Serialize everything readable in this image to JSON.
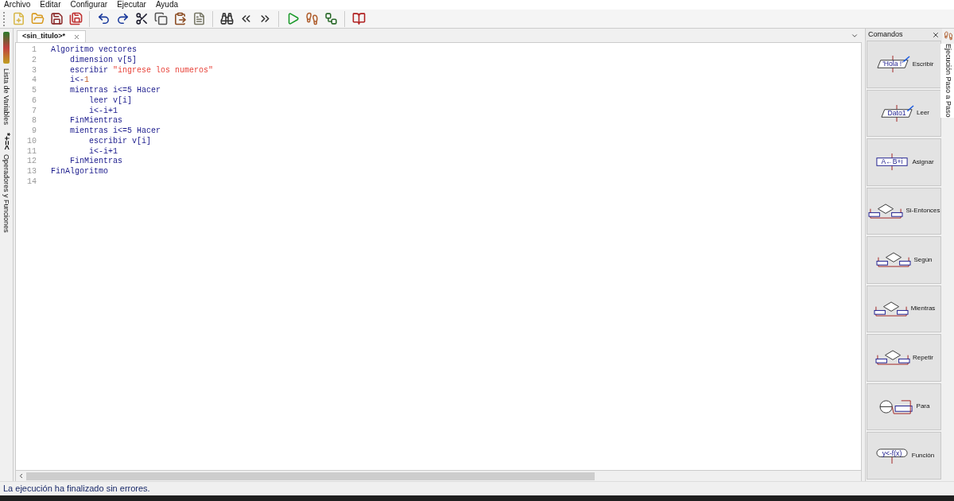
{
  "menu": [
    {
      "label": "Archivo"
    },
    {
      "label": "Editar"
    },
    {
      "label": "Configurar"
    },
    {
      "label": "Ejecutar"
    },
    {
      "label": "Ayuda"
    }
  ],
  "left_panel": {
    "variables_label": "Lista de Variables",
    "operators_symbols": "*+=<",
    "operators_label": "Operadores y Funciones"
  },
  "tabs": [
    {
      "label": "<sin_titulo>*",
      "selected": true
    }
  ],
  "code": [
    {
      "number": "1",
      "tokens": [
        {
          "kind": "keyword",
          "text": "Algoritmo vectores"
        }
      ]
    },
    {
      "number": "2",
      "tokens": [
        {
          "kind": "keyword",
          "text": "    dimension v[5]"
        }
      ]
    },
    {
      "number": "3",
      "tokens": [
        {
          "kind": "keyword",
          "text": "    escribir "
        },
        {
          "kind": "string",
          "text": "\"ingrese los numeros\""
        }
      ]
    },
    {
      "number": "4",
      "tokens": [
        {
          "kind": "keyword",
          "text": "    i<-"
        },
        {
          "kind": "number",
          "text": "1"
        }
      ]
    },
    {
      "number": "5",
      "tokens": [
        {
          "kind": "keyword",
          "text": "    mientras i<=5 Hacer"
        }
      ]
    },
    {
      "number": "6",
      "tokens": [
        {
          "kind": "keyword",
          "text": "        leer v[i]"
        }
      ]
    },
    {
      "number": "7",
      "tokens": [
        {
          "kind": "keyword",
          "text": "        i<-i+1"
        }
      ]
    },
    {
      "number": "8",
      "tokens": [
        {
          "kind": "keyword",
          "text": "    FinMientras"
        }
      ]
    },
    {
      "number": "9",
      "tokens": [
        {
          "kind": "keyword",
          "text": "    mientras i<=5 Hacer"
        }
      ]
    },
    {
      "number": "10",
      "tokens": [
        {
          "kind": "keyword",
          "text": "        escribir v[i]"
        }
      ]
    },
    {
      "number": "11",
      "tokens": [
        {
          "kind": "keyword",
          "text": "        i<-i+1"
        }
      ]
    },
    {
      "number": "12",
      "tokens": [
        {
          "kind": "keyword",
          "text": "    FinMientras"
        }
      ]
    },
    {
      "number": "13",
      "tokens": [
        {
          "kind": "keyword",
          "text": "FinAlgoritmo"
        }
      ]
    },
    {
      "number": "14"
    }
  ],
  "commands_panel": {
    "title": "Comandos",
    "items": [
      {
        "kind": "escribir",
        "label": "Escribir",
        "icon_text": "'Hola !'"
      },
      {
        "kind": "leer",
        "label": "Leer",
        "icon_text": "Dato1"
      },
      {
        "kind": "asignar",
        "label": "Asignar",
        "icon_text": "A←B+i"
      },
      {
        "kind": "si",
        "label": "Si-Entonces"
      },
      {
        "kind": "segun",
        "label": "Según"
      },
      {
        "kind": "mientras",
        "label": "Mientras"
      },
      {
        "kind": "repetir",
        "label": "Repetir"
      },
      {
        "kind": "para",
        "label": "Para"
      },
      {
        "kind": "funcion",
        "label": "Función",
        "icon_text": "y<-f(x)"
      }
    ]
  },
  "side_tab": {
    "label": "Ejecución Paso a Paso"
  },
  "status_bar": "La ejecución ha finalizado sin errores."
}
